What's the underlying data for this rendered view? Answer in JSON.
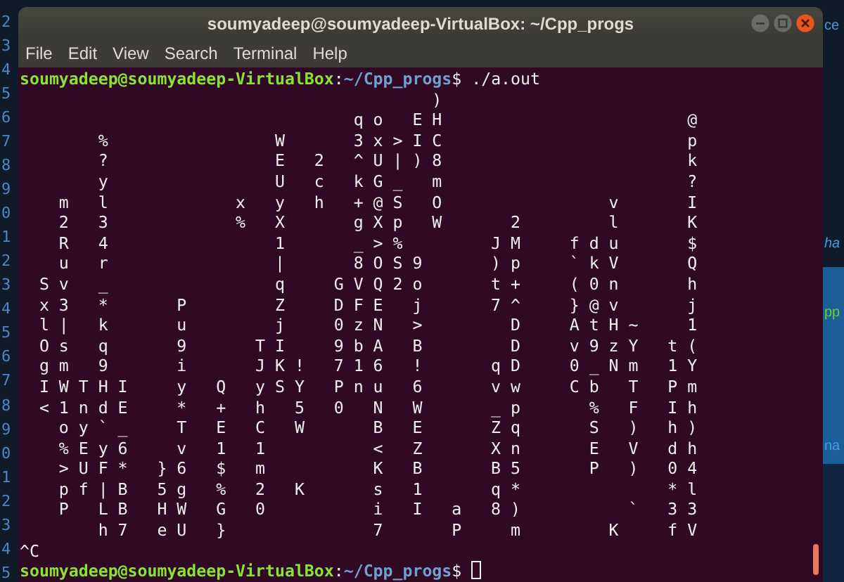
{
  "editor_background": {
    "line_numbers": [
      "2",
      "3",
      "4",
      "5",
      "6",
      "7",
      "8",
      "9",
      "0",
      "1",
      "2",
      "3",
      "4",
      "5",
      "6",
      "7",
      "8",
      "9",
      "0",
      "1",
      "2",
      "3",
      "4",
      "5"
    ],
    "fragments": [
      {
        "text": "ce",
        "color": "#4a9be0"
      },
      {
        "text": "ha",
        "color": "#4a9be0"
      },
      {
        "text": "pp",
        "color": "#6ccf3a"
      },
      {
        "text": "na",
        "color": "#4a9be0"
      }
    ]
  },
  "window": {
    "title": "soumyadeep@soumyadeep-VirtualBox: ~/Cpp_progs"
  },
  "menu": [
    "File",
    "Edit",
    "View",
    "Search",
    "Terminal",
    "Help"
  ],
  "terminal": {
    "lines": [
      {
        "kind": "prompt",
        "user_host": "soumyadeep@soumyadeep-VirtualBox",
        "separator": ":",
        "path": "~/Cpp_progs",
        "symbol": "$",
        "command": " ./a.out",
        "cursor": false
      },
      {
        "kind": "output",
        "text": "                                          )"
      },
      {
        "kind": "output",
        "text": "                                  q o   E H                         @"
      },
      {
        "kind": "output",
        "text": "        %                 W       3 x > I C                         p"
      },
      {
        "kind": "output",
        "text": "        ?                 E   2   ^ U | ) 8                         k"
      },
      {
        "kind": "output",
        "text": "        y                 U   c   k G _   m                         ?"
      },
      {
        "kind": "output",
        "text": "    m   l             x   y   h   + @ S   O                 v       I"
      },
      {
        "kind": "output",
        "text": "    2   3             %   X       g X p   W       2         l       K"
      },
      {
        "kind": "output",
        "text": "    R   4                 1       _ > %         J M     f d u       $"
      },
      {
        "kind": "output",
        "text": "    u   r                 |       8 O S 9       ) p     ` k V       Q"
      },
      {
        "kind": "output",
        "text": "  S v   _                 q     G V Q 2 o       t +     ( 0 n       h"
      },
      {
        "kind": "output",
        "text": "  x 3   *       P         Z     D F E   j       7 ^     } @ v       j"
      },
      {
        "kind": "output",
        "text": "  l |   k       u         j     0 z N   >         D     A t H ~     1"
      },
      {
        "kind": "output",
        "text": "  O s   q       9       T I     9 b A   B         D     v 9 z Y   t ("
      },
      {
        "kind": "output",
        "text": "  g m   9       i       J K !   7 1 6   !       q D     0 _ N m   1 Y"
      },
      {
        "kind": "output",
        "text": "  I W T H I     y   Q   y S Y   P n u   6       v w     C b   T   P m"
      },
      {
        "kind": "output",
        "text": "  < 1 n d E     *   +   h   5   0   N   W       _ p       %   F   I h"
      },
      {
        "kind": "output",
        "text": "    o y ` _     T   E   C   W       B   E       Z q       S   )   h )"
      },
      {
        "kind": "output",
        "text": "    % E y 6     v   1   1           <   Z       X n       E   V   d h"
      },
      {
        "kind": "output",
        "text": "    > U F *   } 6   $   m           K   B       B 5       P   )   0 4"
      },
      {
        "kind": "output",
        "text": "    p f | B   5 g   %   2   K       s   1       q *               * l"
      },
      {
        "kind": "output",
        "text": "    P   L B   H W   G   0           i   I   a   8 )           `   3 3"
      },
      {
        "kind": "output",
        "text": "        h 7   e U   }               7       P     m         K     f V"
      },
      {
        "kind": "output",
        "text": "^C"
      },
      {
        "kind": "prompt",
        "user_host": "soumyadeep@soumyadeep-VirtualBox",
        "separator": ":",
        "path": "~/Cpp_progs",
        "symbol": "$",
        "cursor": true
      }
    ]
  }
}
